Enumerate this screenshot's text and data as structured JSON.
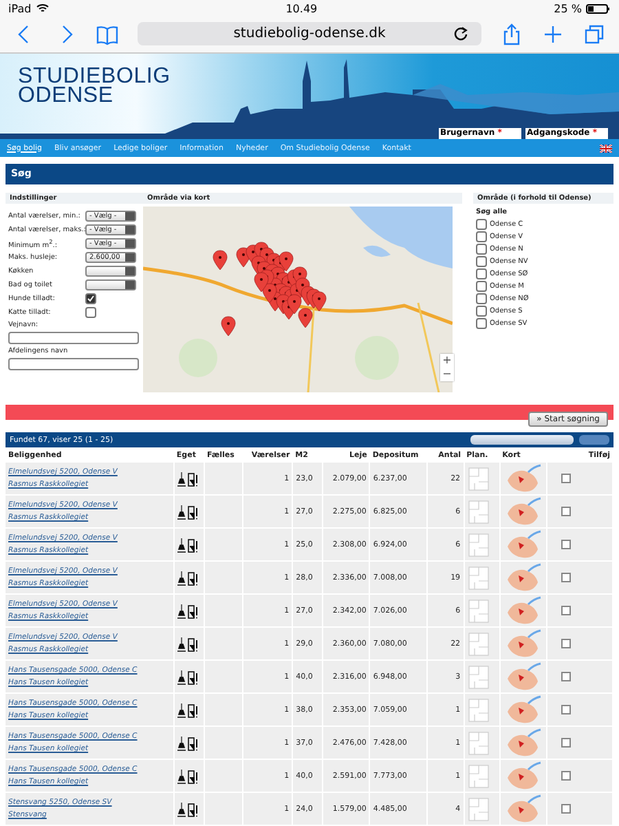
{
  "status_bar": {
    "device": "iPad",
    "time": "10.49",
    "battery": "25 %"
  },
  "browser": {
    "url": "studiebolig-odense.dk"
  },
  "header": {
    "logo_lines": [
      "STUDIEBOLIG",
      "ODENSE"
    ],
    "login_fields": [
      {
        "label": "Brugernavn",
        "mark": "*"
      },
      {
        "label": "Adgangskode",
        "mark": "*"
      }
    ]
  },
  "nav": {
    "items": [
      {
        "label": "Søg bolig",
        "selected": true
      },
      {
        "label": "Bliv ansøger",
        "selected": false
      },
      {
        "label": "Ledige boliger",
        "selected": false
      },
      {
        "label": "Information",
        "selected": false
      },
      {
        "label": "Nyheder",
        "selected": false
      },
      {
        "label": "Om Studiebolig Odense",
        "selected": false
      },
      {
        "label": "Kontakt",
        "selected": false
      }
    ]
  },
  "search": {
    "title": "Søg",
    "settings_heading": "Indstillinger",
    "map_heading": "Område via kort",
    "area_heading": "Område (i forhold til Odense)",
    "settings": [
      {
        "kind": "select",
        "label": "Antal værelser, min.:",
        "value": "- Vælg -"
      },
      {
        "kind": "select",
        "label": "Antal værelser, maks.:",
        "value": "- Vælg -"
      },
      {
        "kind": "select",
        "label": "Minimum m$^{2}$.:",
        "value": "- Vælg -"
      },
      {
        "kind": "select",
        "label": "Maks. husleje:",
        "value": "2.600,00"
      },
      {
        "kind": "select",
        "label": "Køkken"
      },
      {
        "kind": "select",
        "label": "Bad og toilet"
      },
      {
        "kind": "checkbox",
        "label": "Hunde tilladt:",
        "checked": true
      },
      {
        "kind": "checkbox",
        "label": "Katte tilladt:",
        "checked": false
      },
      {
        "kind": "text",
        "label": "Vejnavn:"
      },
      {
        "kind": "text",
        "label": "Afdelingens navn"
      }
    ],
    "map_zoom": [
      "+",
      "−"
    ],
    "search_all": "Søg alle",
    "areas": [
      {
        "label": "Odense C",
        "checked": false
      },
      {
        "label": "Odense V",
        "checked": false
      },
      {
        "label": "Odense N",
        "checked": false
      },
      {
        "label": "Odense NV",
        "checked": false
      },
      {
        "label": "Odense SØ",
        "checked": false
      },
      {
        "label": "Odense M",
        "checked": false
      },
      {
        "label": "Odense NØ",
        "checked": false
      },
      {
        "label": "Odense S",
        "checked": false
      },
      {
        "label": "Odense SV",
        "checked": false
      }
    ],
    "start_button": "» Start søgning"
  },
  "results": {
    "summary": "Fundet 67, viser 25 (1 - 25)",
    "columns": [
      "Beliggenhed",
      "Eget",
      "Fælles",
      "Værelser",
      "M2",
      "Leje",
      "Depositum",
      "Antal",
      "Plan.",
      "Kort",
      "Tilføj"
    ],
    "rows": [
      {
        "address": "Elmelundsvej 5200, Odense V",
        "name": "Rasmus Raskkollegiet",
        "rooms": "1",
        "m2": "23,0",
        "rent": "2.079,00",
        "deposit": "6.237,00",
        "count": "22",
        "checked": false
      },
      {
        "address": "Elmelundsvej 5200, Odense V",
        "name": "Rasmus Raskkollegiet",
        "rooms": "1",
        "m2": "27,0",
        "rent": "2.275,00",
        "deposit": "6.825,00",
        "count": "6",
        "checked": false
      },
      {
        "address": "Elmelundsvej 5200, Odense V",
        "name": "Rasmus Raskkollegiet",
        "rooms": "1",
        "m2": "25,0",
        "rent": "2.308,00",
        "deposit": "6.924,00",
        "count": "6",
        "checked": false
      },
      {
        "address": "Elmelundsvej 5200, Odense V",
        "name": "Rasmus Raskkollegiet",
        "rooms": "1",
        "m2": "28,0",
        "rent": "2.336,00",
        "deposit": "7.008,00",
        "count": "19",
        "checked": false
      },
      {
        "address": "Elmelundsvej 5200, Odense V",
        "name": "Rasmus Raskkollegiet",
        "rooms": "1",
        "m2": "27,0",
        "rent": "2.342,00",
        "deposit": "7.026,00",
        "count": "6",
        "checked": false
      },
      {
        "address": "Elmelundsvej 5200, Odense V",
        "name": "Rasmus Raskkollegiet",
        "rooms": "1",
        "m2": "29,0",
        "rent": "2.360,00",
        "deposit": "7.080,00",
        "count": "22",
        "checked": false
      },
      {
        "address": "Hans Tausensgade 5000, Odense C",
        "name": "Hans Tausen kollegiet",
        "rooms": "1",
        "m2": "40,0",
        "rent": "2.316,00",
        "deposit": "6.948,00",
        "count": "3",
        "checked": false
      },
      {
        "address": "Hans Tausensgade 5000, Odense C",
        "name": "Hans Tausen kollegiet",
        "rooms": "1",
        "m2": "38,0",
        "rent": "2.353,00",
        "deposit": "7.059,00",
        "count": "1",
        "checked": false
      },
      {
        "address": "Hans Tausensgade 5000, Odense C",
        "name": "Hans Tausen kollegiet",
        "rooms": "1",
        "m2": "37,0",
        "rent": "2.476,00",
        "deposit": "7.428,00",
        "count": "1",
        "checked": false
      },
      {
        "address": "Hans Tausensgade 5000, Odense C",
        "name": "Hans Tausen kollegiet",
        "rooms": "1",
        "m2": "40,0",
        "rent": "2.591,00",
        "deposit": "7.773,00",
        "count": "1",
        "checked": false
      },
      {
        "address": "Stensvang 5250, Odense SV",
        "name": "Stensvang",
        "rooms": "1",
        "m2": "24,0",
        "rent": "1.579,00",
        "deposit": "4.485,00",
        "count": "4",
        "checked": false
      }
    ]
  }
}
